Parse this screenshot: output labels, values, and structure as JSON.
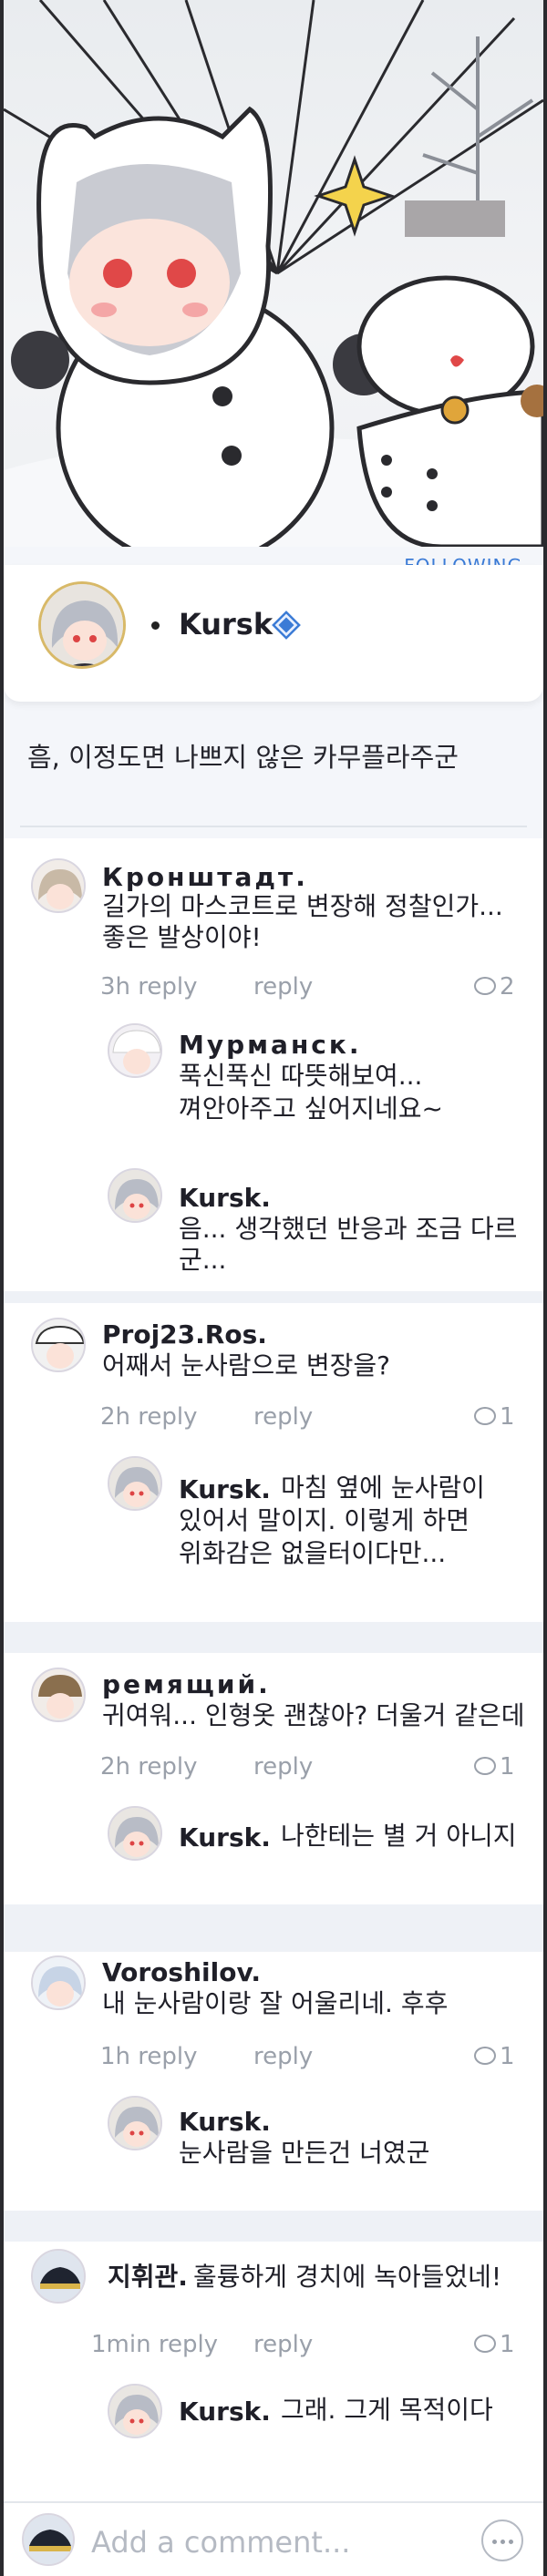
{
  "hero": {
    "sparkle_icon": "sparkle-icon"
  },
  "following_label": "FOLLOWING",
  "profile": {
    "name": "Kursk",
    "verified_icon": "verified-badge-icon"
  },
  "post": {
    "text": "흠, 이정도면 나쁘지 않은 카무플라주군"
  },
  "comments": [
    {
      "name": "Кронштадт.",
      "text1": "길가의 마스코트로 변장해 정찰인가...",
      "text2": "좋은 발상이야!",
      "time": "3h reply",
      "reply_label": "reply",
      "reply_count": "2",
      "replies": [
        {
          "name": "Мурманск.",
          "text1": "푹신푹신 따뜻해보여...",
          "text2": "껴안아주고 싶어지네요~"
        },
        {
          "name": "Kursk.",
          "text1": "음... 생각했던 반응과 조금 다르군..."
        }
      ]
    },
    {
      "name": "Proj23.Ros.",
      "text1": "어째서 눈사람으로 변장을?",
      "time": "2h reply",
      "reply_label": "reply",
      "reply_count": "1",
      "replies": [
        {
          "name": "Kursk.",
          "text1": "마침 옆에 눈사람이",
          "text2": "있어서 말이지. 이렇게 하면",
          "text3": "위화감은 없을터이다만..."
        }
      ]
    },
    {
      "name": "ремящий.",
      "text1": "귀여워... 인형옷 괜찮아? 더울거 같은데",
      "time": "2h reply",
      "reply_label": "reply",
      "reply_count": "1",
      "replies": [
        {
          "name": "Kursk.",
          "text1": "나한테는 별 거 아니지"
        }
      ]
    },
    {
      "name": "Voroshilov.",
      "text1": "내 눈사람이랑 잘 어울리네. 후후",
      "time": "1h reply",
      "reply_label": "reply",
      "reply_count": "1",
      "replies": [
        {
          "name": "Kursk.",
          "text1": "눈사람을 만든건 너였군"
        }
      ]
    },
    {
      "name": "지휘관.",
      "text1": "훌륭하게 경치에 녹아들었네!",
      "time": "1min reply",
      "reply_label": "reply",
      "reply_count": "1",
      "replies": [
        {
          "name": "Kursk.",
          "text1": "그래. 그게 목적이다"
        }
      ]
    }
  ],
  "bottom": {
    "placeholder": "Add a comment...",
    "more_icon": "more-dots-icon"
  }
}
